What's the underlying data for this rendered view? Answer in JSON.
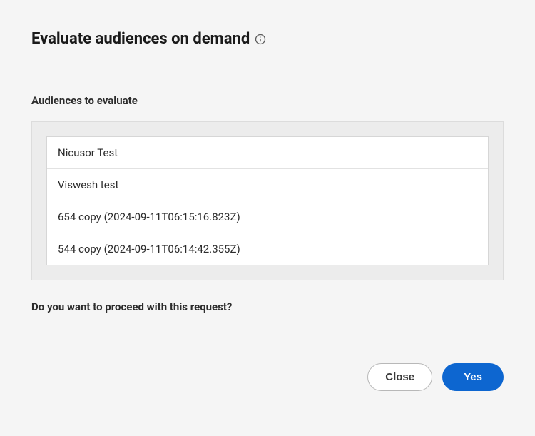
{
  "title": "Evaluate audiences on demand",
  "section_label": "Audiences to evaluate",
  "audiences": [
    "Nicusor Test",
    "Viswesh test",
    "654 copy (2024-09-11T06:15:16.823Z)",
    "544 copy (2024-09-11T06:14:42.355Z)"
  ],
  "confirm_text": "Do you want to proceed with this request?",
  "buttons": {
    "close": "Close",
    "yes": "Yes"
  }
}
